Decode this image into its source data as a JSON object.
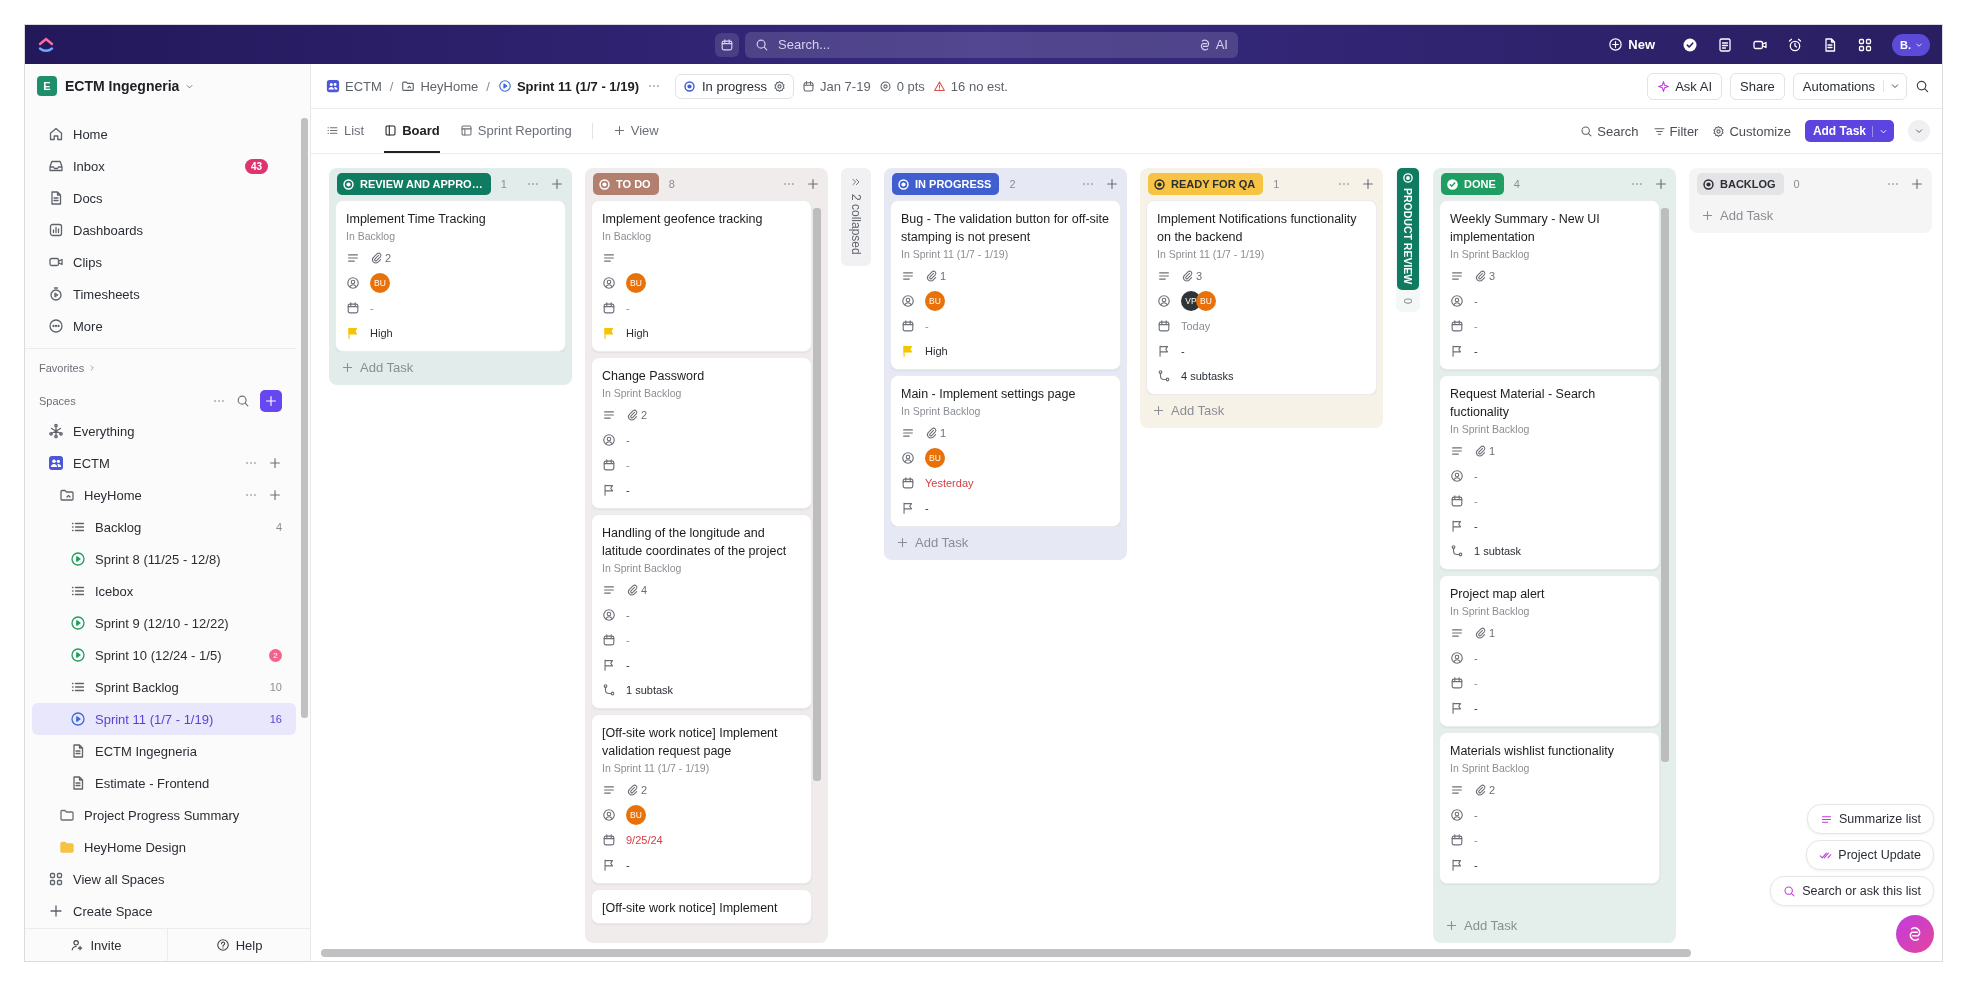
{
  "topbar": {
    "search_placeholder": "Search...",
    "ai_label": "AI",
    "new_label": "New",
    "avatar": "B."
  },
  "sidebar": {
    "workspace": {
      "initial": "E",
      "name": "ECTM Ingegneria"
    },
    "nav": [
      {
        "label": "Home"
      },
      {
        "label": "Inbox",
        "badge": "43"
      },
      {
        "label": "Docs"
      },
      {
        "label": "Dashboards"
      },
      {
        "label": "Clips"
      },
      {
        "label": "Timesheets"
      },
      {
        "label": "More"
      }
    ],
    "favorites": "Favorites",
    "spaces": "Spaces",
    "tree": [
      {
        "label": "Everything",
        "kind": "everything",
        "selected": false
      },
      {
        "label": "ECTM",
        "kind": "space",
        "selected": false,
        "children": [
          {
            "label": "HeyHome",
            "kind": "shared-folder",
            "selected": false,
            "children": [
              {
                "label": "Backlog",
                "kind": "list",
                "count": "4",
                "selected": false
              },
              {
                "label": "Sprint 8 (11/25 - 12/8)",
                "kind": "sprint",
                "selected": false
              },
              {
                "label": "Icebox",
                "kind": "list",
                "selected": false
              },
              {
                "label": "Sprint 9 (12/10 - 12/22)",
                "kind": "sprint",
                "selected": false
              },
              {
                "label": "Sprint 10 (12/24 - 1/5)",
                "kind": "sprint",
                "badge": "2",
                "selected": false
              },
              {
                "label": "Sprint Backlog",
                "kind": "list",
                "count": "10",
                "selected": false
              },
              {
                "label": "Sprint 11 (1/7 - 1/19)",
                "kind": "sprint",
                "count": "16",
                "selected": true
              },
              {
                "label": "ECTM Ingegneria",
                "kind": "doc",
                "selected": false
              },
              {
                "label": "Estimate - Frontend",
                "kind": "doc",
                "selected": false
              }
            ]
          },
          {
            "label": "Project Progress Summary",
            "kind": "folder",
            "selected": false
          },
          {
            "label": "HeyHome Design",
            "kind": "folder",
            "color": "#f5c242",
            "selected": false
          }
        ]
      }
    ],
    "footer_links": [
      {
        "label": "View all Spaces"
      },
      {
        "label": "Create Space"
      }
    ],
    "bottom": [
      {
        "label": "Invite"
      },
      {
        "label": "Help"
      }
    ]
  },
  "header": {
    "breadcrumb": [
      {
        "label": "ECTM",
        "kind": "space"
      },
      {
        "label": "HeyHome",
        "kind": "shared-folder"
      },
      {
        "label": "Sprint 11 (1/7 - 1/19)",
        "kind": "sprint"
      }
    ],
    "separator": "/",
    "status": "In progress",
    "dates": "Jan 7-19",
    "points": "0 pts",
    "estimate": "16 no est.",
    "actions": [
      {
        "label": "Ask AI"
      },
      {
        "label": "Share"
      },
      {
        "label": "Automations"
      }
    ]
  },
  "views": {
    "tabs": [
      {
        "label": "List",
        "selected": false
      },
      {
        "label": "Board",
        "selected": true
      },
      {
        "label": "Sprint Reporting",
        "selected": false
      }
    ],
    "add_view": "View",
    "tools": [
      {
        "label": "Search"
      },
      {
        "label": "Filter"
      },
      {
        "label": "Customize"
      }
    ],
    "add_task": "Add Task"
  },
  "board": {
    "columns": [
      {
        "kind": "list",
        "status": "REVIEW AND APPRO…",
        "count": "1",
        "color": "#0f7b61",
        "done": false,
        "add_task": "Add Task",
        "cards": [
          {
            "title": "Implement Time Tracking",
            "location": "In Backlog",
            "attachments": "2",
            "assignees": [
              {
                "initials": "BU",
                "color": "#e8710a"
              }
            ],
            "date": {
              "text": "-",
              "overdue": false
            },
            "priority": {
              "text": "High",
              "high": true
            }
          }
        ]
      },
      {
        "kind": "list",
        "status": "TO DO",
        "count": "8",
        "color": "#b3806f",
        "done": false,
        "scroll": true,
        "cards": [
          {
            "title": "Implement geofence tracking",
            "location": "In Backlog",
            "assignees": [
              {
                "initials": "BU",
                "color": "#e8710a"
              }
            ],
            "date": {
              "text": "-",
              "overdue": false
            },
            "priority": {
              "text": "High",
              "high": true
            }
          },
          {
            "title": "Change Password",
            "location": "In Sprint Backlog",
            "attachments": "2",
            "assignee": "-",
            "date": {
              "text": "-",
              "overdue": false
            },
            "priority": {
              "text": "-",
              "high": false
            }
          },
          {
            "title": "Handling of the longitude and latitude coordinates of the project",
            "location": "In Sprint Backlog",
            "attachments": "4",
            "assignee": "-",
            "date": {
              "text": "-",
              "overdue": false
            },
            "priority": {
              "text": "-",
              "high": false
            },
            "subtasks": "1 subtask"
          },
          {
            "title": "[Off-site work notice] Implement validation request page",
            "location": "In Sprint 11 (1/7 - 1/19)",
            "attachments": "2",
            "assignees": [
              {
                "initials": "BU",
                "color": "#e8710a"
              }
            ],
            "date": {
              "text": "9/25/24",
              "overdue": true
            },
            "priority": {
              "text": "-",
              "high": false
            }
          },
          {
            "title": "[Off-site work notice] Implement"
          }
        ]
      },
      {
        "kind": "collapsed-group",
        "label": "2 collapsed"
      },
      {
        "kind": "list",
        "status": "IN PROGRESS",
        "count": "2",
        "color": "#3f5fd1",
        "done": false,
        "add_task": "Add Task",
        "cards": [
          {
            "title": "Bug - The validation button for off-site stamping is not present",
            "location": "In Sprint 11 (1/7 - 1/19)",
            "attachments": "1",
            "assignees": [
              {
                "initials": "BU",
                "color": "#e8710a"
              }
            ],
            "date": {
              "text": "-",
              "overdue": false
            },
            "priority": {
              "text": "High",
              "high": true
            }
          },
          {
            "title": "Main - Implement settings page",
            "location": "In Sprint Backlog",
            "attachments": "1",
            "assignees": [
              {
                "initials": "BU",
                "color": "#e8710a"
              }
            ],
            "date": {
              "text": "Yesterday",
              "overdue": true
            },
            "priority": {
              "text": "-",
              "high": false
            }
          }
        ]
      },
      {
        "kind": "list",
        "status": "READY FOR QA",
        "count": "1",
        "color": "#f6c343",
        "done": false,
        "add_task": "Add Task",
        "cards": [
          {
            "title": "Implement Notifications functionality on the backend",
            "location": "In Sprint 11 (1/7 - 1/19)",
            "attachments": "3",
            "assignees": [
              {
                "initials": "VP",
                "color": "#2f3437"
              },
              {
                "initials": "BU",
                "color": "#e8710a"
              }
            ],
            "date": {
              "text": "Today",
              "overdue": false
            },
            "priority": {
              "text": "-",
              "high": false
            },
            "subtasks": "4 subtasks"
          }
        ]
      },
      {
        "kind": "collapsed",
        "status": "PRODUCT REVIEW",
        "count": "0",
        "color": "#0f7b61"
      },
      {
        "kind": "list",
        "status": "DONE",
        "count": "4",
        "color": "#1f9d63",
        "done": true,
        "add_task": "Add Task",
        "scroll": true,
        "cards": [
          {
            "title": "Weekly Summary - New UI implementation",
            "location": "In Sprint Backlog",
            "attachments": "3",
            "assignee": "-",
            "date": {
              "text": "-",
              "overdue": false
            },
            "priority": {
              "text": "-",
              "high": false
            }
          },
          {
            "title": "Request Material - Search fuctionality",
            "location": "In Sprint Backlog",
            "attachments": "1",
            "assignee": "-",
            "date": {
              "text": "-",
              "overdue": false
            },
            "priority": {
              "text": "-",
              "high": false
            },
            "subtasks": "1 subtask"
          },
          {
            "title": "Project map alert",
            "location": "In Sprint Backlog",
            "attachments": "1",
            "assignee": "-",
            "date": {
              "text": "-",
              "overdue": false
            },
            "priority": {
              "text": "-",
              "high": false
            }
          },
          {
            "title": "Materials wishlist functionality",
            "location": "In Sprint Backlog",
            "attachments": "2",
            "assignee": "-",
            "date": {
              "text": "-",
              "overdue": false
            },
            "priority": {
              "text": "-",
              "high": false
            }
          }
        ]
      },
      {
        "kind": "list",
        "status": "BACKLOG",
        "count": "0",
        "color": "#e4e4e6",
        "done": false,
        "add_task": "Add Task"
      }
    ]
  },
  "assistant": {
    "actions": [
      {
        "label": "Summarize list"
      },
      {
        "label": "Project Update"
      },
      {
        "label": "Search or ask this list"
      }
    ]
  }
}
